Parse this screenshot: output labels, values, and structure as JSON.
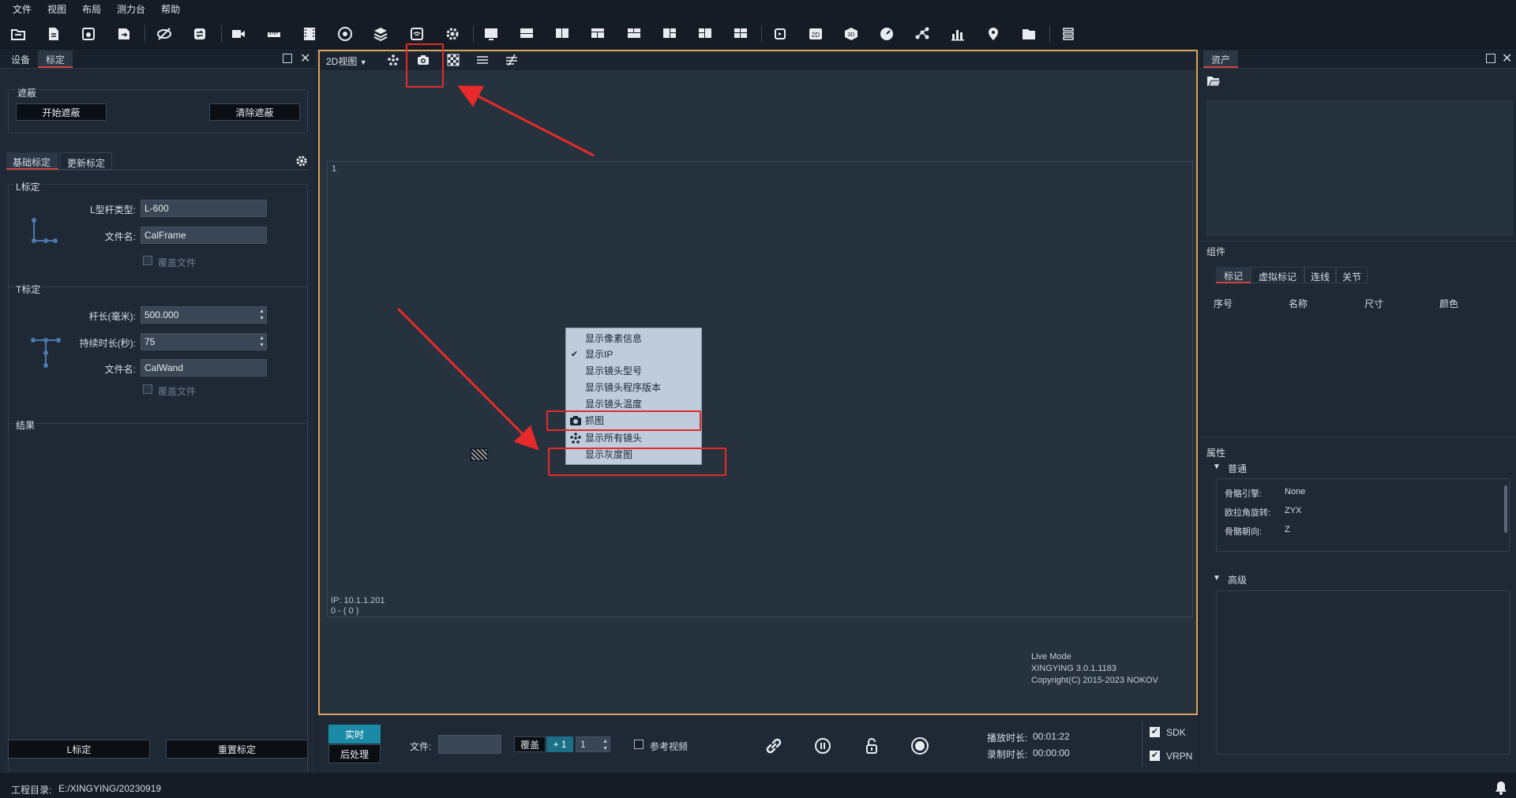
{
  "menu": [
    "文件",
    "视图",
    "布局",
    "测力台",
    "帮助"
  ],
  "toolbar": {
    "icons": [
      "open-folder-icon",
      "new-file-icon",
      "save-icon",
      "save-as-icon",
      "hide-icon",
      "sync-icon",
      "video-icon",
      "ruler-icon",
      "film-icon",
      "record-icon",
      "layers-icon",
      "wifi-camera-icon",
      "settings-icon",
      "layout-single-icon",
      "layout-rows-icon",
      "layout-cols-icon",
      "layout-grid-icon",
      "layout-top-icon",
      "layout-split-icon",
      "layout-left-icon",
      "layout-quad-icon",
      "rotate-icon",
      "view-2d-icon",
      "view-3d-icon",
      "gauge-icon",
      "skeleton-icon",
      "chart-icon",
      "location-icon",
      "folder-icon",
      "list-icon"
    ]
  },
  "left": {
    "tabs": [
      "设备",
      "标定"
    ],
    "mask": {
      "title": "遮蔽",
      "start": "开始遮蔽",
      "clear": "清除遮蔽"
    },
    "subtabs": [
      "基础标定",
      "更新标定"
    ],
    "l_cal": {
      "title": "L标定",
      "type_label": "L型杆类型:",
      "type_value": "L-600",
      "file_label": "文件名:",
      "file_value": "CalFrame",
      "overwrite": "覆盖文件"
    },
    "t_cal": {
      "title": "T标定",
      "len_label": "杆长(毫米):",
      "len_value": "500.000",
      "dur_label": "持续时长(秒):",
      "dur_value": "75",
      "file_label": "文件名:",
      "file_value": "CalWand",
      "overwrite": "覆盖文件"
    },
    "result": {
      "title": "结果"
    },
    "buttons": {
      "l_cal": "L标定",
      "reset": "重置标定"
    }
  },
  "view": {
    "mode": "2D视图",
    "cam_num": "1",
    "ip": "IP: 10.1.1.201",
    "fps": "0 - ( 0 )",
    "live": "Live Mode",
    "version": "XINGYING 3.0.1.1183",
    "copyright": "Copyright(C) 2015-2023 NOKOV",
    "context_menu": [
      "显示像素信息",
      "显示IP",
      "显示镜头型号",
      "显示镜头程序版本",
      "显示镜头温度",
      "抓图",
      "显示所有镜头",
      "显示灰度图"
    ]
  },
  "bottom": {
    "realtime": "实时",
    "post": "后处理",
    "file_label": "文件:",
    "overlay": "覆盖",
    "plus": "+ 1",
    "spin_val": "1",
    "ref_video": "参考视频",
    "play_label": "播放时长:",
    "play_val": "00:01:22",
    "rec_label": "录制时长:",
    "rec_val": "00:00:00",
    "sdk": "SDK",
    "vrpn": "VRPN"
  },
  "right": {
    "tab": "资产",
    "components": "组件",
    "comp_tabs": [
      "标记",
      "虚拟标记",
      "连线",
      "关节"
    ],
    "cols": [
      "序号",
      "名称",
      "尺寸",
      "颜色"
    ],
    "props": "属性",
    "normal": "普通",
    "props_items": [
      {
        "k": "骨骼引擎:",
        "v": "None"
      },
      {
        "k": "欧拉角旋转:",
        "v": "ZYX"
      },
      {
        "k": "骨骼朝向:",
        "v": "Z"
      }
    ],
    "advanced": "高级"
  },
  "status": {
    "label": "工程目录:",
    "path": "E:/XINGYING/20230919"
  }
}
